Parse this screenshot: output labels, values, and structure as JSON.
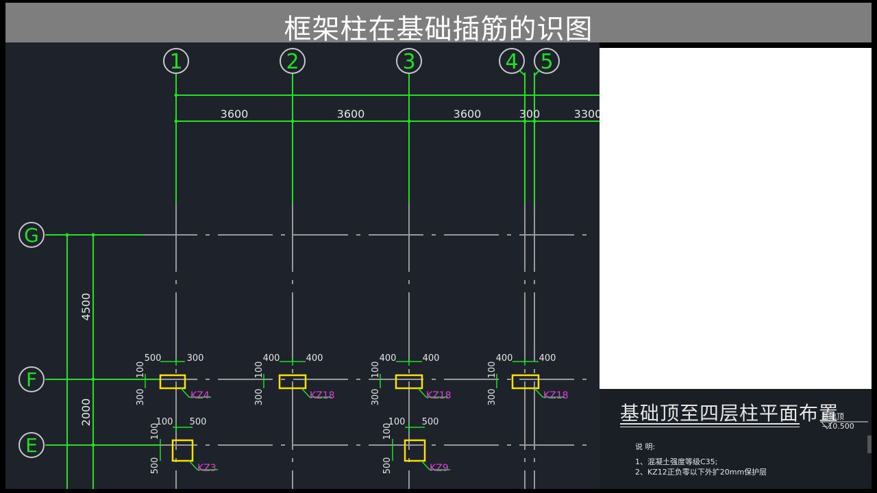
{
  "video": {
    "title": "框架柱在基础插筋的识图"
  },
  "axes": {
    "vertical": [
      "1",
      "2",
      "3",
      "4",
      "5"
    ],
    "horizontal": [
      "G",
      "F",
      "E"
    ]
  },
  "dimensions": {
    "top": [
      "3600",
      "3600",
      "3600",
      "300",
      "3300"
    ],
    "left": [
      "4500",
      "2000"
    ]
  },
  "columns": [
    {
      "label": "KZ4",
      "left": "500",
      "right": "300",
      "top": "100",
      "bottom": "300"
    },
    {
      "label": "KZ18",
      "left": "400",
      "right": "400",
      "top": "100",
      "bottom": "300"
    },
    {
      "label": "KZ18",
      "left": "400",
      "right": "400",
      "top": "100",
      "bottom": "300"
    },
    {
      "label": "KZ18",
      "left": "400",
      "right": "400",
      "top": "100",
      "bottom": "300"
    },
    {
      "label": "KZ3",
      "left": "100",
      "right": "500",
      "top": "100",
      "bottom": "500"
    },
    {
      "label": "KZ9",
      "left": "100",
      "right": "500",
      "top": "100",
      "bottom": "500"
    }
  ],
  "legend": {
    "drawing_title": "基础顶至四层柱平面布置",
    "elevation": "基础顶~10.500",
    "notes_title": "说 明:",
    "notes": [
      "1、混凝土强度等级C35;",
      "2、KZ12正负零以下外扩20mm保护层"
    ]
  },
  "colors": {
    "background": "#1e222a",
    "axis_green": "#22e022",
    "grid_gray": "#9a9a9a",
    "column_yellow": "#ffe000",
    "column_label": "#e040e0",
    "dim_text": "#e6e6e6"
  }
}
